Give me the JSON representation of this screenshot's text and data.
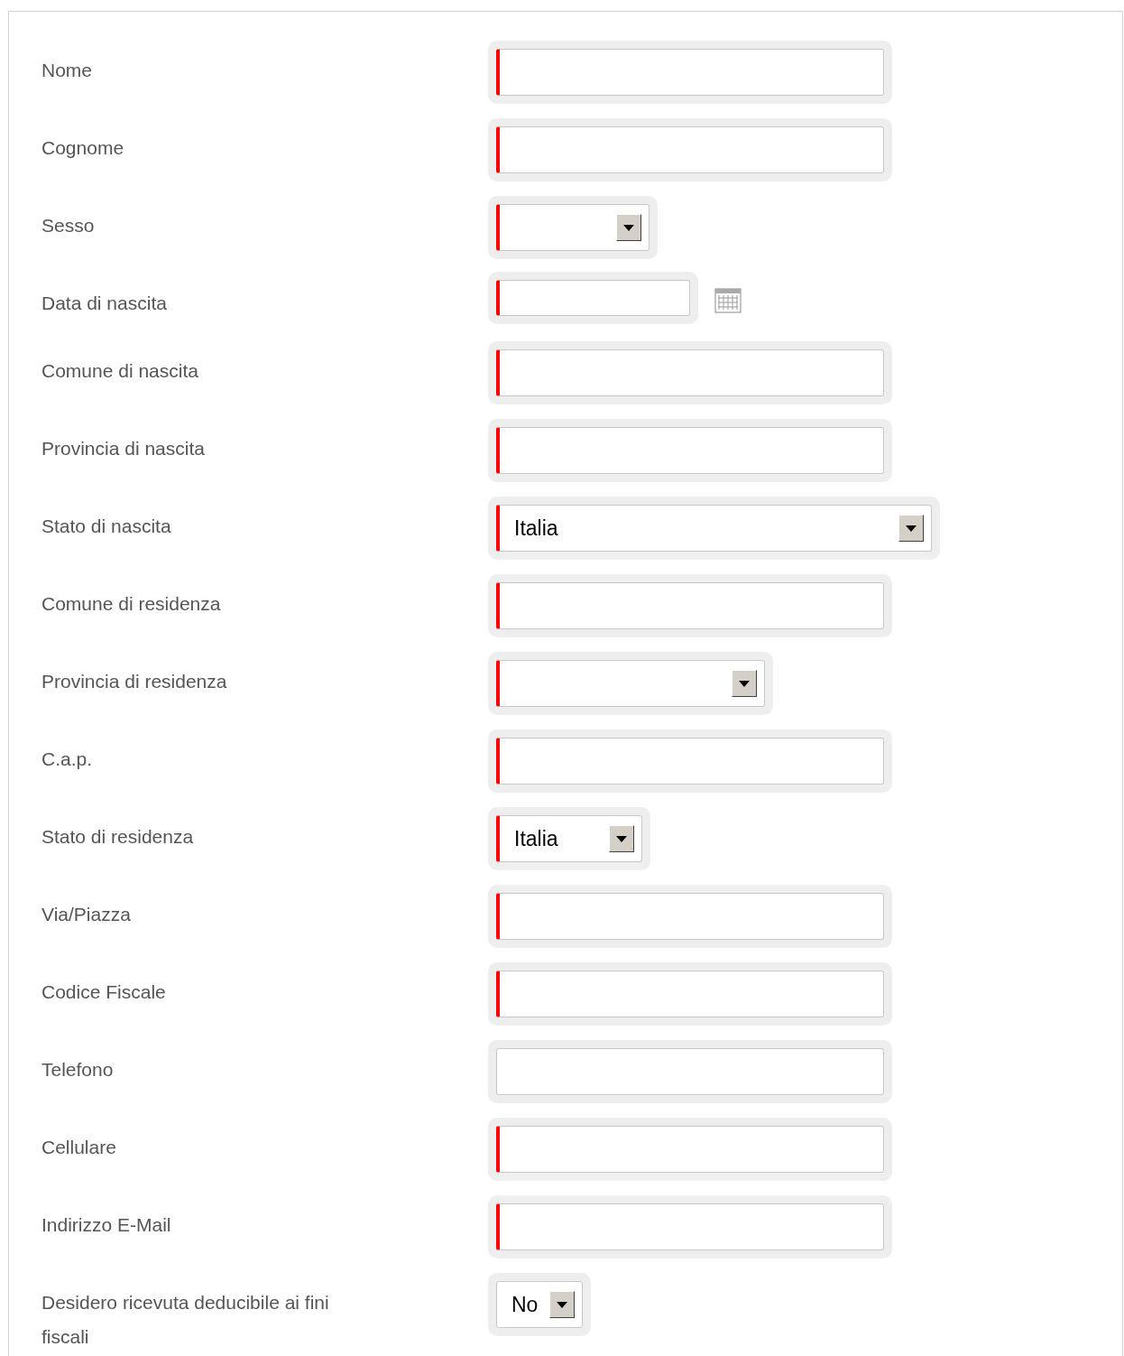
{
  "fields": [
    {
      "label": "Nome",
      "kind": "text",
      "required": true
    },
    {
      "label": "Cognome",
      "kind": "text",
      "required": true
    },
    {
      "label": "Sesso",
      "kind": "select",
      "required": true
    },
    {
      "label": "Data di nascita",
      "kind": "date",
      "required": true
    },
    {
      "label": "Comune di nascita",
      "kind": "text",
      "required": true
    },
    {
      "label": "Provincia di nascita",
      "kind": "text",
      "required": true
    },
    {
      "label": "Stato di nascita",
      "kind": "select",
      "required": true,
      "value": "Italia"
    },
    {
      "label": "Comune di residenza",
      "kind": "text",
      "required": true
    },
    {
      "label": "Provincia di residenza",
      "kind": "select",
      "required": true
    },
    {
      "label": "C.a.p.",
      "kind": "text",
      "required": true
    },
    {
      "label": "Stato di residenza",
      "kind": "select",
      "required": true,
      "value": "Italia"
    },
    {
      "label": "Via/Piazza",
      "kind": "text",
      "required": true
    },
    {
      "label": "Codice Fiscale",
      "kind": "text",
      "required": true
    },
    {
      "label": "Telefono",
      "kind": "text",
      "required": false
    },
    {
      "label": "Cellulare",
      "kind": "text",
      "required": true
    },
    {
      "label": "Indirizzo E-Mail",
      "kind": "text",
      "required": true
    },
    {
      "label": "Desidero ricevuta deducibile ai fini fiscali",
      "kind": "select",
      "required": false,
      "value": "No"
    }
  ]
}
